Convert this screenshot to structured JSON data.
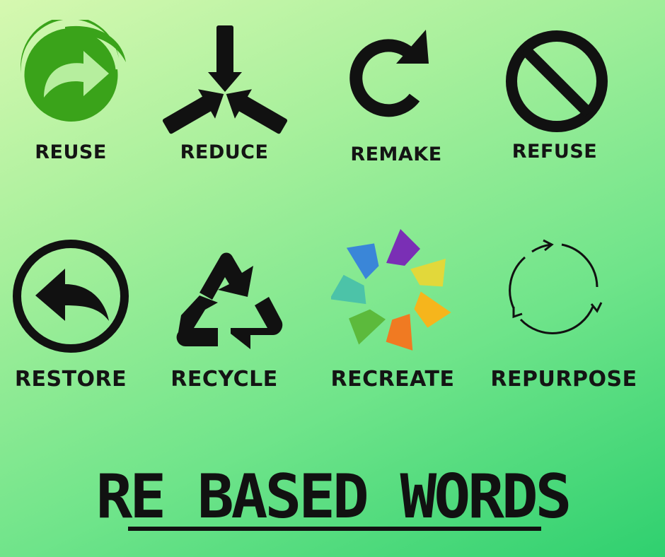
{
  "words": {
    "reuse": "REUSE",
    "reduce": "REDUCE",
    "remake": "REMAKE",
    "refuse": "REFUSE",
    "restore": "RESTORE",
    "recycle": "RECYCLE",
    "recreate": "RECREATE",
    "repurpose": "REPURPOSE"
  },
  "icons": {
    "reuse": "green-dot-arrow-icon",
    "reduce": "three-arrows-converge-icon",
    "remake": "clockwise-arrow-icon",
    "refuse": "prohibition-icon",
    "restore": "back-arrow-circle-icon",
    "recycle": "recycle-symbol-icon",
    "recreate": "colorful-paper-planes-icon",
    "repurpose": "circular-arrows-icon"
  },
  "title": "RE BASED WORDS",
  "colors": {
    "reuse_green": "#3aa31a",
    "text": "#141414",
    "recreate_palette": [
      "#7a2fb5",
      "#3a86d8",
      "#4cc3a8",
      "#5cba3c",
      "#f07a22",
      "#f6b51c",
      "#e2d83a"
    ]
  }
}
